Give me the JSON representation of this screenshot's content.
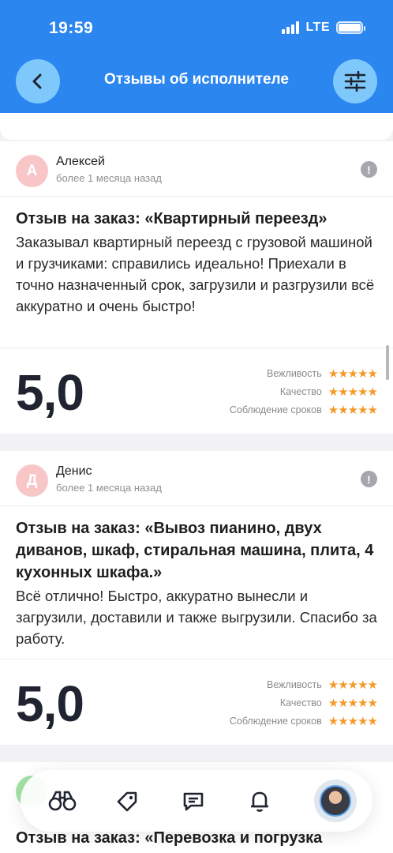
{
  "status_bar": {
    "time": "19:59",
    "network": "LTE"
  },
  "header": {
    "title": "Отзывы об исполнителе",
    "back_icon": "chevron-left-icon",
    "filter_icon": "sliders-icon"
  },
  "reviews": [
    {
      "initial": "А",
      "author": "Алексей",
      "posted": "более 1 месяца назад",
      "title": "Отзыв на заказ: «Квартирный переезд»",
      "text": "Заказывал квартирный переезд с грузовой машиной и грузчиками: справились идеально! Приехали в точно назначенный срок, загрузили и разгрузили всё аккуратно и очень быстро!",
      "score": "5,0",
      "criteria": [
        {
          "label": "Вежливость",
          "stars": "★★★★★"
        },
        {
          "label": "Качество",
          "stars": "★★★★★"
        },
        {
          "label": "Соблюдение сроков",
          "stars": "★★★★★"
        }
      ]
    },
    {
      "initial": "Д",
      "author": "Денис",
      "posted": "более 1 месяца назад",
      "title": "Отзыв на заказ: «Вывоз пианино, двух диванов, шкаф, стиральная машина, плита, 4 кухонных шкафа.»",
      "text": "Всё отлично! Быстро, аккуратно вынесли и загрузили, доставили и также выгрузили. Спасибо за работу.",
      "score": "5,0",
      "criteria": [
        {
          "label": "Вежливость",
          "stars": "★★★★★"
        },
        {
          "label": "Качество",
          "stars": "★★★★★"
        },
        {
          "label": "Соблюдение сроков",
          "stars": "★★★★★"
        }
      ]
    }
  ],
  "partial_review": {
    "title": "Отзыв на заказ: «Перевозка и погрузка"
  },
  "tab_bar": {
    "items": [
      {
        "icon": "binoculars-icon"
      },
      {
        "icon": "tag-icon"
      },
      {
        "icon": "chat-icon"
      },
      {
        "icon": "notifications-icon"
      },
      {
        "icon": "profile-avatar"
      }
    ]
  },
  "colors": {
    "accent": "#2b86f0",
    "star": "#f59a2a",
    "avatar_bg": "#f9c6c8"
  }
}
